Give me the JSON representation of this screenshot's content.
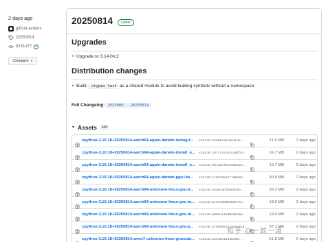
{
  "sidebar": {
    "published": "2 days ago",
    "author": "github-actions",
    "tag": "20250814",
    "commit": "d231d77",
    "compare_label": "Compare"
  },
  "release": {
    "title": "20250814",
    "badge": "Latest",
    "upgrades_heading": "Upgrades",
    "upgrades": [
      "Upgrade to 3.14.0rc2"
    ],
    "distribution_heading": "Distribution changes",
    "distribution_prefix": "Build",
    "distribution_code": "_ctypes_test",
    "distribution_suffix": "as a shared module to avoid leaking symbols without a namespace",
    "changelog_label": "Full Changelog:",
    "changelog_link": "2025080...20250814"
  },
  "assets": {
    "title": "Assets",
    "count": "649",
    "rows": [
      {
        "name": "cpython-3.10.18+20250814-aarch64-apple-darwin-debug-f...",
        "sha": "sha256:35eb8526c0e2635...",
        "size": "21.6 MB",
        "date": "2 days ago"
      },
      {
        "name": "cpython-3.10.18+20250814-aarch64-apple-darwin-install_o...",
        "sha": "sha256:18fc7cec4ce38fb57...",
        "size": "16.7 MB",
        "date": "2 days ago"
      },
      {
        "name": "cpython-3.10.18+20250814-aarch64-apple-darwin-install_o...",
        "sha": "sha256:9b158ef82d4a032a...",
        "size": "16.7 MB",
        "date": "2 days ago"
      },
      {
        "name": "cpython-3.10.18+20250814-aarch64-apple-darwin-pgo+lto...",
        "sha": "sha256:c76a450247f48e46...",
        "size": "30.9 MB",
        "date": "2 days ago"
      },
      {
        "name": "cpython-3.10.18+20250814-aarch64-unknown-linux-gnu-d...",
        "sha": "sha256:b3a67acda4ed5d5...",
        "size": "55.2 MB",
        "date": "2 days ago"
      },
      {
        "name": "cpython-3.10.18+20250814-aarch64-unknown-linux-gnu-in...",
        "sha": "sha256:b1e42408698df7b2...",
        "size": "19.0 MB",
        "date": "2 days ago"
      },
      {
        "name": "cpython-3.10.18+20250814-aarch64-unknown-linux-gnu-in...",
        "sha": "sha256:6999214300c66ab6...",
        "size": "19.0 MB",
        "date": "2 days ago"
      },
      {
        "name": "cpython-3.10.18+20250814-aarch64-unknown-linux-gnu-p...",
        "sha": "sha256:5795b9a532aaea418...",
        "size": "37.1 MB",
        "date": "2 days ago"
      },
      {
        "name": "cpython-3.10.18+20250814-armv7-unknown-linux-gnueabi...",
        "sha": "sha256:a3e3b418d46ed0...",
        "size": "51.8 MB",
        "date": "2 days ago"
      }
    ]
  },
  "watermark": "知乎 @一致一道",
  "colors": {
    "link": "#0969da",
    "latest_badge": "#1a7f37",
    "border": "#d1d9e0",
    "muted_text": "#59636e"
  }
}
